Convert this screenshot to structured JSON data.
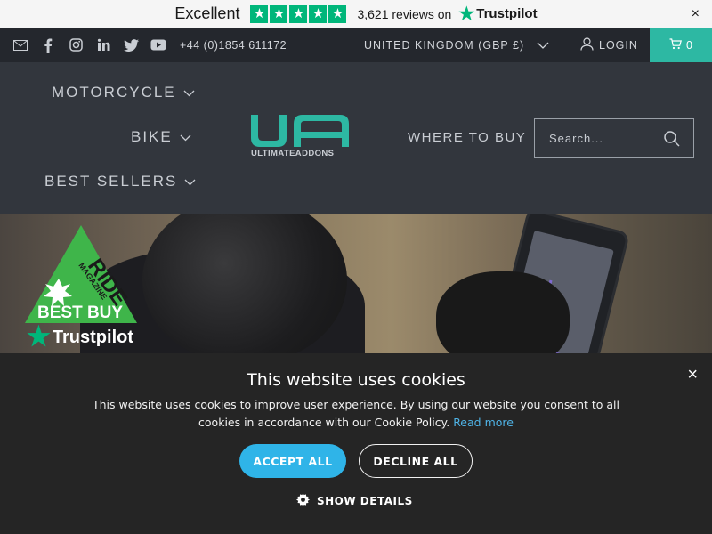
{
  "trustpilot_bar": {
    "rating_text": "Excellent",
    "reviews_text": "3,621 reviews on",
    "brand": "Trustpilot",
    "star_color": "#00b67a",
    "close_label": "×"
  },
  "utility_bar": {
    "icons": [
      "email-icon",
      "facebook-icon",
      "instagram-icon",
      "linkedin-icon",
      "twitter-icon",
      "youtube-icon"
    ],
    "phone": "+44 (0)1854 611172",
    "currency": "UNITED KINGDOM (GBP £)",
    "login": "LOGIN",
    "cart_count": "0",
    "accent_color": "#2db8a3"
  },
  "header": {
    "nav": {
      "motorcycle": "MOTORCYCLE",
      "bike": "BIKE",
      "best_sellers": "BEST SELLERS",
      "where_to_buy": "WHERE TO BUY"
    },
    "logo_text": "ULTIMATEADDONS",
    "search_placeholder": "Search..."
  },
  "hero": {
    "badge": {
      "ride": "RIDE",
      "magazine": "MAGAZINE",
      "best_buy": "BEST BUY"
    },
    "trustpilot": "Trustpilot"
  },
  "cookie_banner": {
    "title": "This website uses cookies",
    "text": "This website uses cookies to improve user experience. By using our website you consent to all cookies in accordance with our Cookie Policy.",
    "read_more": "Read more",
    "accept": "ACCEPT ALL",
    "decline": "DECLINE ALL",
    "show_details": "SHOW DETAILS",
    "close_label": "×",
    "accent_color": "#2fb4e8"
  }
}
